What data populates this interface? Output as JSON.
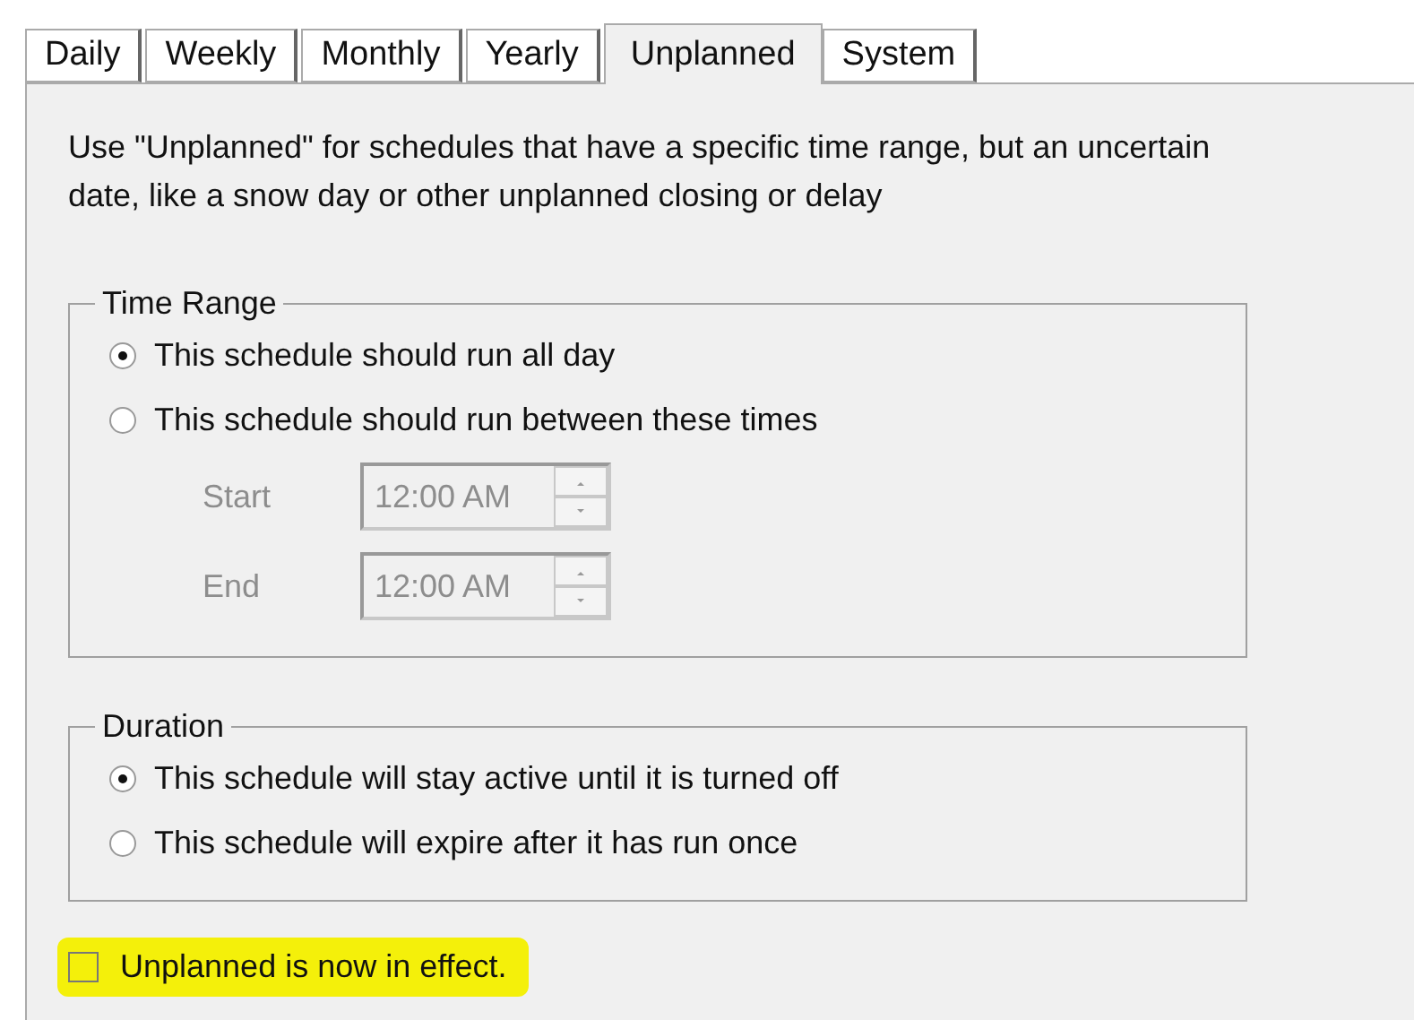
{
  "tabs": [
    {
      "label": "Daily",
      "selected": false
    },
    {
      "label": "Weekly",
      "selected": false
    },
    {
      "label": "Monthly",
      "selected": false
    },
    {
      "label": "Yearly",
      "selected": false
    },
    {
      "label": "Unplanned",
      "selected": true
    },
    {
      "label": "System",
      "selected": false
    }
  ],
  "description": "Use \"Unplanned\" for schedules that have a specific time range, but an uncertain date, like a snow day or other unplanned closing or delay",
  "time_range": {
    "title": "Time Range",
    "options": [
      {
        "label": "This schedule should run all day",
        "selected": true
      },
      {
        "label": "This schedule should run between these times",
        "selected": false
      }
    ],
    "times": [
      {
        "label": "Start",
        "value": "12:00 AM",
        "disabled": true
      },
      {
        "label": "End",
        "value": "12:00 AM",
        "disabled": true
      }
    ]
  },
  "duration": {
    "title": "Duration",
    "options": [
      {
        "label": "This schedule will stay active until it is turned off",
        "selected": true
      },
      {
        "label": "This schedule will expire after it has run once",
        "selected": false
      }
    ]
  },
  "effect_checkbox": {
    "label": "Unplanned is now in effect.",
    "checked": false,
    "highlighted": true
  }
}
